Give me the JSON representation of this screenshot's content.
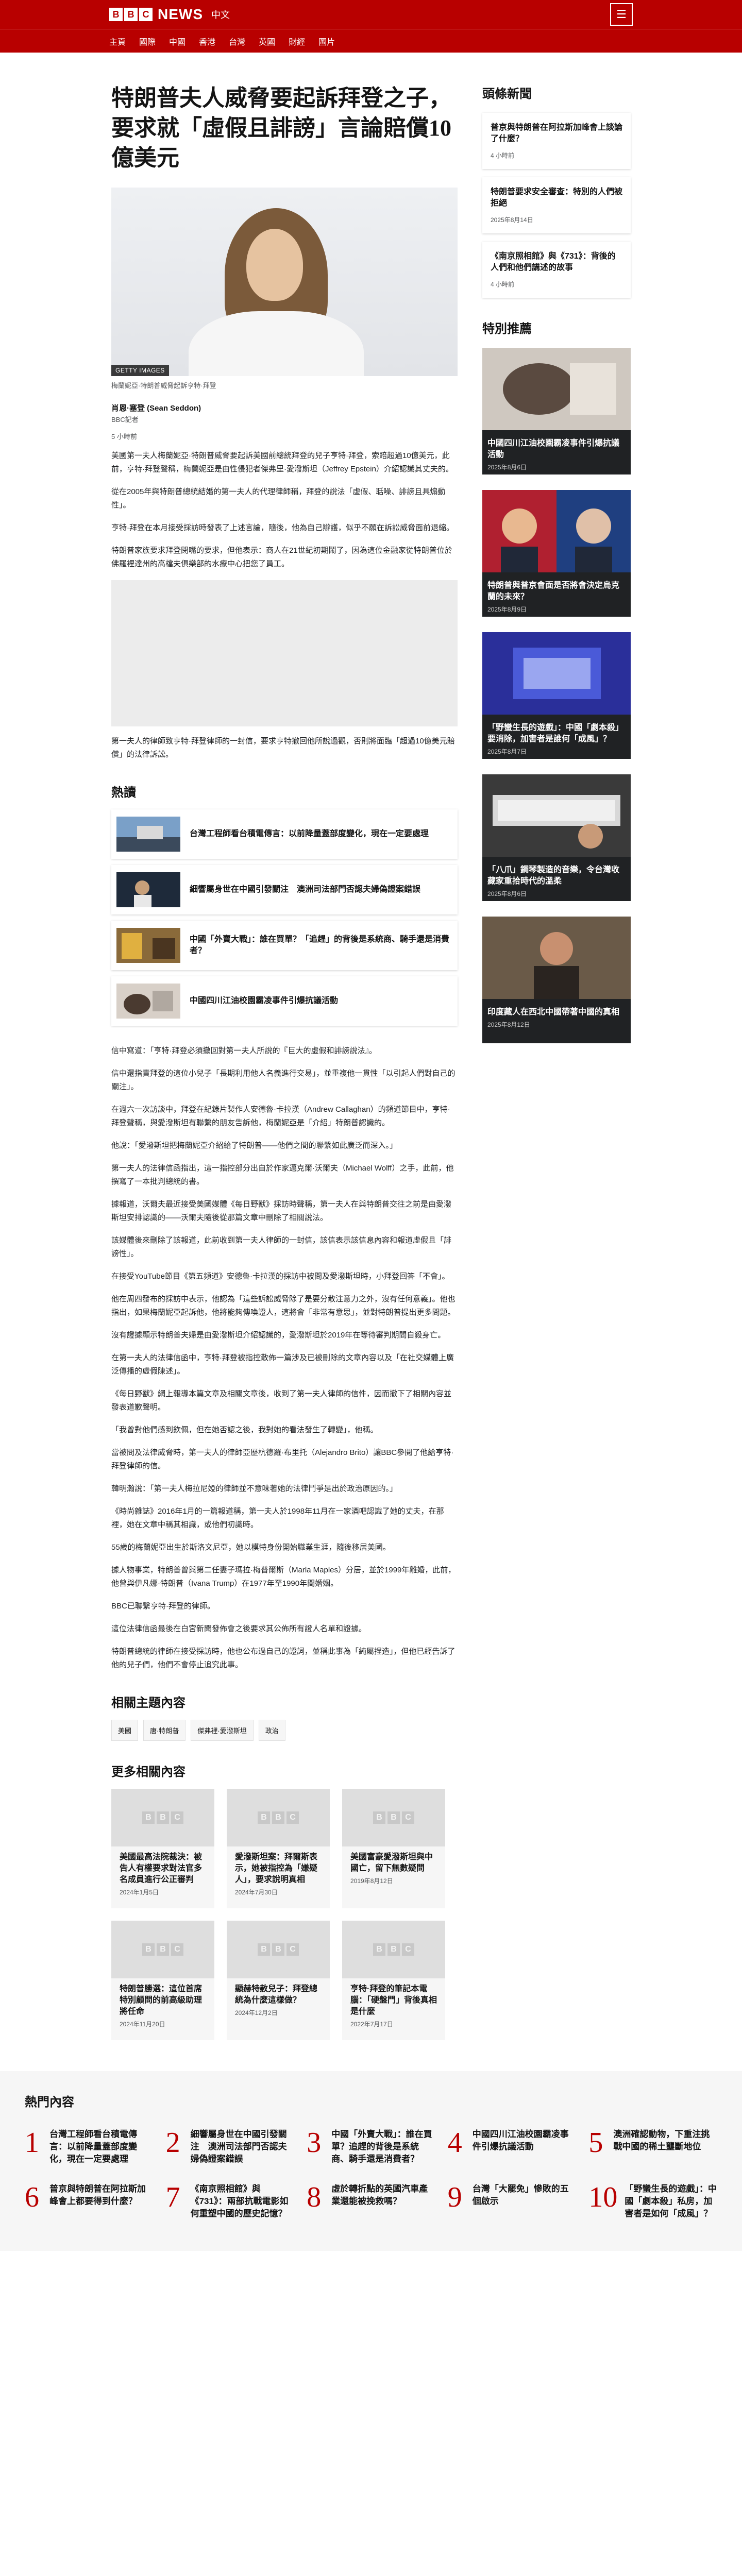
{
  "brand": {
    "logo_letters": [
      "B",
      "B",
      "C"
    ],
    "news_word": "NEWS",
    "language": "中文",
    "accent": "#b80000"
  },
  "nav": [
    "主頁",
    "國際",
    "中國",
    "香港",
    "台灣",
    "英國",
    "財經",
    "圖片"
  ],
  "article": {
    "headline": "特朗普夫人威脅要起訴拜登之子，要求就「虛假且誹謗」言論賠償10億美元",
    "hero_credit": "GETTY IMAGES",
    "hero_caption": "梅蘭妮亞·特朗普威脅起訴亨特·拜登",
    "author": "肖恩·塞登 (Sean Seddon)",
    "author_role": "BBC記者",
    "date": "5 小時前",
    "paragraphs_a": [
      "美國第一夫人梅蘭妮亞·特朗普威脅要起訴美國前總統拜登的兒子亨特·拜登，索賠超過10億美元，此前，亨特·拜登聲稱，梅蘭妮亞是由性侵犯者傑弗里·愛潑斯坦（Jeffrey Epstein）介紹認識其丈夫的。",
      "從在2005年與特朗普總統結婚的第一夫人的代理律師稱，拜登的說法「虛假、聒噪、誹謗且具煽動性」。",
      "亨特·拜登在本月接受採訪時發表了上述言論，隨後，他為自己辯護，似乎不願在訴訟威脅面前退縮。",
      "特朗普家族要求拜登閉嘴的要求，但他表示：商人在21世紀初期鬧了，因為這位金融家從特朗普位於佛羅裡達州的高檔夫俱樂部的水療中心把您了員工。"
    ],
    "video_caption": "第一夫人的律師致亨特·拜登律師的一封信，要求亨特撤回他所說過觀，否則將面臨「超過10億美元賠償」的法律訴訟。",
    "paragraphs_b": [
      "信中寫道：「亨特·拜登必須撤回對第一夫人所說的『巨大的虛假和誹謗說法』。",
      "信中還指責拜登的這位小兒子「長期利用他人名義進行交易」，並重複他一貫性「以引起人們對自己的關注」。",
      "在週六一次訪談中，拜登在紀錄片製作人安德魯·卡拉漢（Andrew Callaghan）的頻道節目中，亨特·拜登聲稱，與愛潑斯坦有聯繫的朋友告訴他，梅蘭妮亞是「介紹」特朗普認識的。",
      "他說：「愛潑斯坦把梅蘭妮亞介紹給了特朗普——他們之間的聯繫如此廣泛而深入。」",
      "第一夫人的法律信函指出，這一指控部分出自於作家邁克爾·沃爾夫（Michael Wolff）之手，此前，他撰寫了一本批判總統的書。",
      "據報道，沃爾夫最近接受美國媒體《每日野獸》採訪時聲稱，第一夫人在與特朗普交往之前是由愛潑斯坦安排認識的——沃爾夫隨後從那篇文章中刪除了相關說法。",
      "該媒體後來刪除了該報道，此前收到第一夫人律師的一封信，該信表示該信息內容和報道虛假且「誹謗性」。",
      "在接受YouTube節目《第五頻道》安德魯·卡拉漢的採訪中被問及愛潑斯坦時，小拜登回答「不會」。",
      "他在周四發布的採訪中表示，他認為「這些訴訟威脅除了是要分散注意力之外，沒有任何意義」。他也指出，如果梅蘭妮亞起訴他，他將能夠傳喚證人，這將會「非常有意思」，並對特朗普提出更多問題。",
      "沒有證據顯示特朗普夫婦是由愛潑斯坦介紹認識的，愛潑斯坦於2019年在等待審判期間自殺身亡。",
      "在第一夫人的法律信函中，亨特·拜登被指控散佈一篇涉及已被刪除的文章內容以及「在社交媒體上廣泛傳播的虛假陳述」。",
      "《每日野獸》網上報導本篇文章及相關文章後，收到了第一夫人律師的信件，因而撤下了相關內容並發表道歉聲明。",
      "「我曾對他們感到欽佩，但在她否認之後，我對她的看法發生了轉變」，他稱。",
      "當被問及法律威脅時，第一夫人的律師亞歷杭德羅·布里托（Alejandro Brito）讓BBC參閱了他給亨特·拜登律師的信。",
      "韓明瀚說：「第一夫人梅拉尼婭的律師並不意味著她的法律鬥爭是出於政治原因的。」",
      "《時尚雜誌》2016年1月的一篇報道稱，第一夫人於1998年11月在一家酒吧認識了她的丈夫，在那裡，她在文章中稱其相識，或他們初識時。",
      "55歲的梅蘭妮亞出生於斯洛文尼亞，她以模特身份開始職業生涯，隨後移居美國。",
      "據人物事業，特朗普曾與第二任妻子瑪拉·梅普爾斯（Marla Maples）分居，並於1999年離婚，此前，他曾與伊凡娜·特朗普（Ivana Trump）在1977年至1990年間婚姻。",
      "BBC已聯繫亨特·拜登的律師。",
      "這位法律信函最後在白宮新聞發佈會之後要求其公佈所有證人名單和證據。",
      "特朗普總統的律師在接受採訪時，他也公布過自己的證詞，並稱此事為「純屬捏造」，但他已經告訴了他的兒子們，他們不會停止追究此事。"
    ],
    "hot_title": "熱讀",
    "hot_items": [
      "台灣工程師看台積電傳言：以前降量蓋部度變化，現在一定要處理",
      "細響屬身世在中國引發關注　澳洲司法部門否認夫婦偽證案錯誤",
      "中國「外賣大戰」：誰在買單？「追趕」的背後是系統商、騎手還是消費者？",
      "中國四川江油校園霸凌事件引爆抗議活動"
    ],
    "related_topics_title": "相關主題內容",
    "tags": [
      "美國",
      "唐·特朗普",
      "傑弗裡·愛潑斯坦",
      "政治"
    ],
    "more_title": "更多相關內容",
    "more_items": [
      {
        "title": "美國最高法院裁決：被告人有權要求對法官多名成員進行公正審判",
        "date": "2024年1月5日"
      },
      {
        "title": "愛潑斯坦案：拜爾斯表示，她被指控為「嫌疑人」，要求說明真相",
        "date": "2024年7月30日"
      },
      {
        "title": "美國富豪愛潑斯坦與中國亡，留下無數疑問",
        "date": "2019年8月12日"
      },
      {
        "title": "特朗普勝選：這位首席特別顧問的前高級助理將任命",
        "date": "2024年11月20日"
      },
      {
        "title": "顯赫特赦兒子：拜登總統為什麼這樣做？",
        "date": "2024年12月2日"
      },
      {
        "title": "亨特·拜登的筆記本電腦：「硬盤門」背後真相是什麼",
        "date": "2022年7月17日"
      }
    ]
  },
  "sidebar": {
    "lead_title": "頭條新聞",
    "lead_items": [
      {
        "title": "普京與特朗普在阿拉斯加峰會上談論了什麼？",
        "date": "4 小時前"
      },
      {
        "title": "特朗普要求安全審查：特別的人們被拒絕",
        "date": "2025年8月14日"
      },
      {
        "title": "《南京照相館》與《731》：背後的人們和他們講述的故事",
        "date": "4 小時前"
      }
    ],
    "feature_title": "特別推薦",
    "feature_items": [
      {
        "title": "中國四川江油校園霸凌事件引爆抗議活動",
        "date": "2025年8月6日"
      },
      {
        "title": "特朗普與普京會面是否將會決定烏克蘭的未來？",
        "date": "2025年8月9日"
      },
      {
        "title": "「野蠻生長的遊戲」：中國「劇本殺」要消除，加害者是誰何「成風」？",
        "date": "2025年8月7日"
      },
      {
        "title": "「八爪」鋼琴製造的音樂，令台灣收藏家重拾時代的溫柔",
        "date": "2025年8月6日"
      },
      {
        "title": "印度藏人在西北中國帶著中國的真相",
        "date": "2025年8月12日"
      }
    ]
  },
  "popular": {
    "title": "熱門內容",
    "items": [
      {
        "num": "1",
        "text": "台灣工程師看台積電傳言：以前降量蓋部度變化，現在一定要處理"
      },
      {
        "num": "2",
        "text": "細響屬身世在中國引發關注　澳洲司法部門否認夫婦偽證案錯誤"
      },
      {
        "num": "3",
        "text": "中國「外賣大戰」：誰在買單？追趕的背後是系統商、騎手還是消費者？"
      },
      {
        "num": "4",
        "text": "中國四川江油校園霸凌事件引爆抗議活動"
      },
      {
        "num": "5",
        "text": "澳洲確認動物，下重注挑戰中國的稀土壟斷地位"
      },
      {
        "num": "6",
        "text": "普京與特朗普在阿拉斯加峰會上都要得到什麼？"
      },
      {
        "num": "7",
        "text": "《南京照相館》與《731》：兩部抗戰電影如何重塑中國的歷史記憶？"
      },
      {
        "num": "8",
        "text": "虛於轉折點的英國汽車產業還能被挽救嗎？"
      },
      {
        "num": "9",
        "text": "台灣「大罷免」慘敗的五個啟示"
      },
      {
        "num": "10",
        "text": "「野蠻生長的遊戲」：中國「劇本殺」私房，加害者是如何「成風」？"
      }
    ]
  }
}
